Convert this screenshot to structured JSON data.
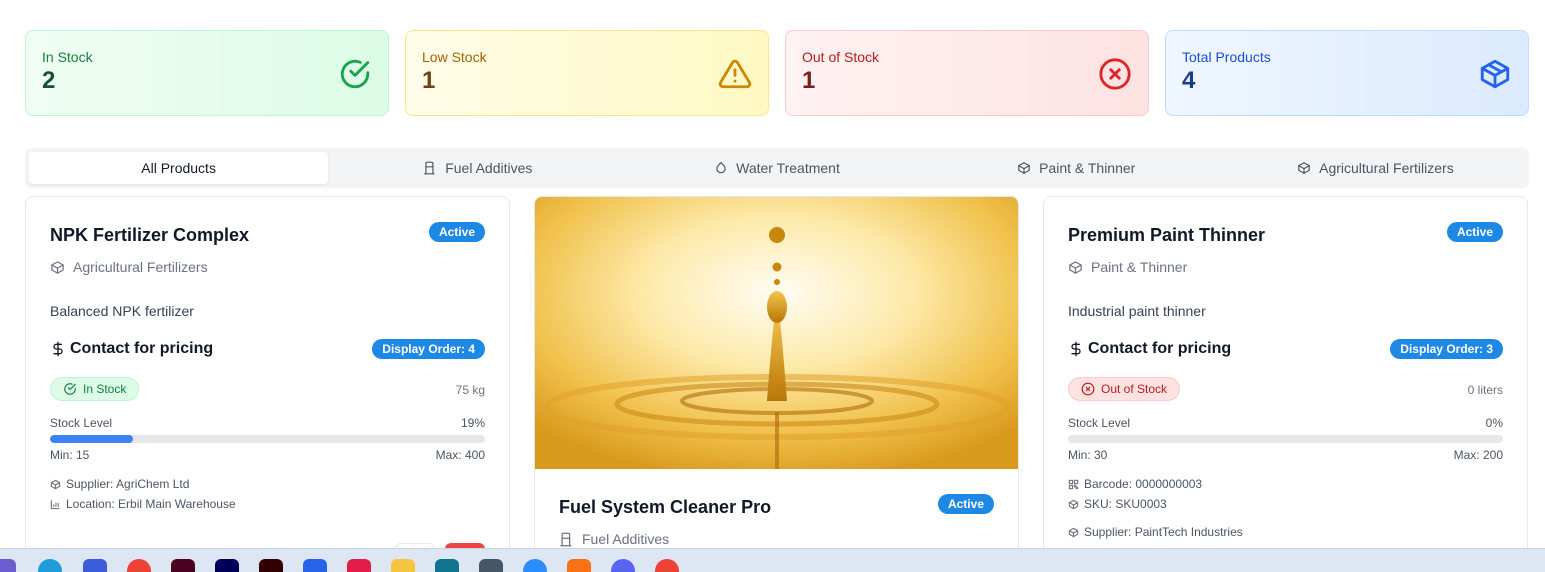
{
  "stats": [
    {
      "label": "In Stock",
      "value": "2",
      "icon": "check-circle-icon",
      "color": "#16a34a"
    },
    {
      "label": "Low Stock",
      "value": "1",
      "icon": "warning-triangle-icon",
      "color": "#ca8a04"
    },
    {
      "label": "Out of Stock",
      "value": "1",
      "icon": "x-circle-icon",
      "color": "#dc2626"
    },
    {
      "label": "Total Products",
      "value": "4",
      "icon": "package-icon",
      "color": "#2563eb"
    }
  ],
  "tabs": [
    {
      "label": "All Products",
      "active": true
    },
    {
      "label": "Fuel Additives",
      "icon": "fuel-icon"
    },
    {
      "label": "Water Treatment",
      "icon": "droplet-icon"
    },
    {
      "label": "Paint & Thinner",
      "icon": "package-icon"
    },
    {
      "label": "Agricultural Fertilizers",
      "icon": "package-icon"
    }
  ],
  "products": [
    {
      "name": "NPK Fertilizer Complex",
      "status": "Active",
      "category": "Agricultural Fertilizers",
      "description": "Balanced NPK fertilizer",
      "price": "Contact for pricing",
      "display_order": "Display Order: 4",
      "stock_status": "In Stock",
      "quantity": "75 kg",
      "stock_level_label": "Stock Level",
      "stock_level_pct": "19%",
      "stock_level_value": 0.19,
      "min": "Min: 15",
      "max": "Max: 400",
      "supplier": "Supplier: AgriChem Ltd",
      "location": "Location: Erbil Main Warehouse"
    },
    {
      "name": "Fuel System Cleaner Pro",
      "status": "Active",
      "category": "Fuel Additives",
      "image": "golden-oil-droplet-photo"
    },
    {
      "name": "Premium Paint Thinner",
      "status": "Active",
      "category": "Paint & Thinner",
      "description": "Industrial paint thinner",
      "price": "Contact for pricing",
      "display_order": "Display Order: 3",
      "stock_status": "Out of Stock",
      "quantity": "0 liters",
      "stock_level_label": "Stock Level",
      "stock_level_pct": "0%",
      "stock_level_value": 0,
      "min": "Min: 30",
      "max": "Max: 200",
      "barcode": "Barcode: 0000000003",
      "sku": "SKU: SKU0003",
      "supplier": "Supplier: PaintTech Industries"
    }
  ],
  "taskbar": {
    "icons": [
      "windows-icon",
      "edge-icon",
      "app-icon",
      "chrome-icon",
      "indesign-icon",
      "premiere-icon",
      "illustrator-icon",
      "app-b-icon",
      "app-a-icon",
      "folder-icon",
      "app-icon",
      "app-icon",
      "zoom-icon",
      "app-icon",
      "discord-icon",
      "chrome-icon"
    ]
  }
}
